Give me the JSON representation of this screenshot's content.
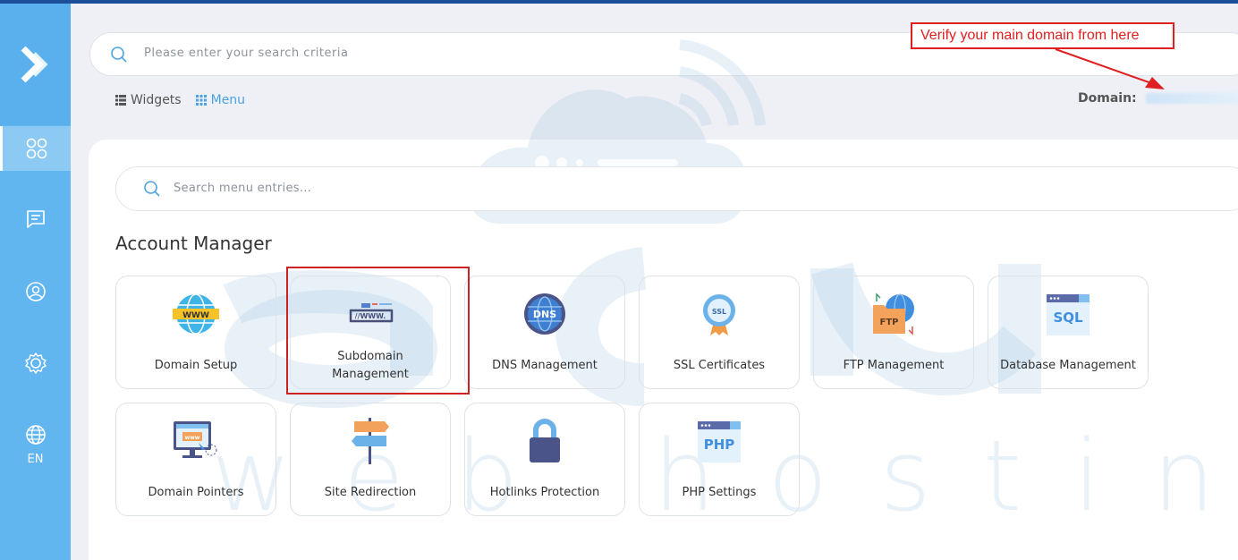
{
  "sidebar": {
    "items": [
      {
        "name": "apps",
        "icon": "apps-grid-icon"
      },
      {
        "name": "messages",
        "icon": "chat-icon"
      },
      {
        "name": "profile",
        "icon": "user-icon"
      },
      {
        "name": "settings",
        "icon": "gear-icon"
      },
      {
        "name": "language",
        "icon": "globe-icon",
        "label": "EN"
      }
    ]
  },
  "search": {
    "placeholder": "Please enter your search criteria"
  },
  "view_toggle": {
    "widgets_label": "Widgets",
    "menu_label": "Menu"
  },
  "domain": {
    "label": "Domain:"
  },
  "callout": {
    "text": "Verify your main domain from here"
  },
  "menu_search": {
    "placeholder": "Search menu entries..."
  },
  "section": {
    "title": "Account Manager",
    "tiles": [
      {
        "label": "Domain Setup",
        "icon": "www-globe-icon"
      },
      {
        "label_line1": "Subdomain",
        "label_line2": "Management",
        "icon": "subdomain-icon"
      },
      {
        "label": "DNS Management",
        "icon": "dns-globe-icon"
      },
      {
        "label": "SSL Certificates",
        "icon": "ssl-badge-icon"
      },
      {
        "label": "FTP Management",
        "icon": "ftp-folder-icon"
      },
      {
        "label": "Database Management",
        "icon": "sql-database-icon"
      },
      {
        "label": "Domain Pointers",
        "icon": "domain-pointer-icon"
      },
      {
        "label": "Site Redirection",
        "icon": "signpost-icon"
      },
      {
        "label": "Hotlinks Protection",
        "icon": "padlock-icon"
      },
      {
        "label": "PHP Settings",
        "icon": "php-window-icon"
      }
    ]
  },
  "watermark": {
    "text": "web hosting"
  },
  "colors": {
    "sidebar": "#62b6f0",
    "accent": "#4ba3e3",
    "callout": "#e02020"
  }
}
